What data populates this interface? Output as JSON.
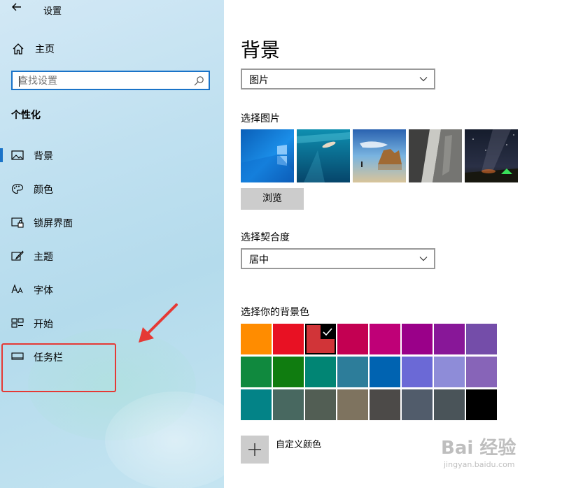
{
  "window": {
    "title": "设置"
  },
  "sidebar": {
    "home_label": "主页",
    "search_placeholder": "查找设置",
    "section_label": "个性化",
    "items": [
      {
        "label": "背景",
        "icon": "image-icon",
        "selected": true
      },
      {
        "label": "颜色",
        "icon": "palette-icon",
        "selected": false
      },
      {
        "label": "锁屏界面",
        "icon": "lock-screen-icon",
        "selected": false
      },
      {
        "label": "主题",
        "icon": "theme-brush-icon",
        "selected": false
      },
      {
        "label": "字体",
        "icon": "font-icon",
        "selected": false
      },
      {
        "label": "开始",
        "icon": "start-menu-icon",
        "selected": false
      },
      {
        "label": "任务栏",
        "icon": "taskbar-icon",
        "selected": false
      }
    ]
  },
  "main": {
    "title": "背景",
    "background_type": {
      "value": "图片"
    },
    "choose_picture_label": "选择图片",
    "pictures": [
      {
        "name": "windows-logo-wallpaper"
      },
      {
        "name": "underwater-swimmer-wallpaper"
      },
      {
        "name": "beach-rocks-wallpaper"
      },
      {
        "name": "rock-waterfall-wallpaper"
      },
      {
        "name": "night-sky-tent-wallpaper"
      }
    ],
    "browse_label": "浏览",
    "fit_label": "选择契合度",
    "fit": {
      "value": "居中"
    },
    "colors_label": "选择你的背景色",
    "colors": [
      [
        "#FF8C00",
        "#E81123",
        "#D13438",
        "#C30052",
        "#BF0077",
        "#9A0089",
        "#881798",
        "#744DA9"
      ],
      [
        "#10893E",
        "#107C10",
        "#018574",
        "#2D7D9A",
        "#0063B1",
        "#6B69D6",
        "#8E8CD8",
        "#8764B8"
      ],
      [
        "#038387",
        "#486860",
        "#525E54",
        "#7E735F",
        "#4C4A48",
        "#515C6B",
        "#4A5459",
        "#000000"
      ]
    ],
    "selected_color": "#D13438",
    "custom_color_label": "自定义颜色"
  },
  "accent_color": "#1a73c8",
  "annotation_color": "#e53935",
  "watermark": {
    "logo_text": "Bai 经验",
    "url_text": "jingyan.baidu.com"
  }
}
